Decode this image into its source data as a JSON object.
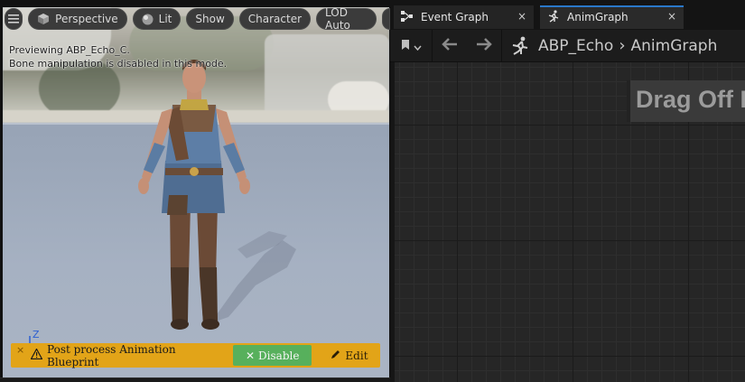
{
  "viewport": {
    "toolbar": {
      "menu_icon": "hamburger-icon",
      "perspective_label": "Perspective",
      "lit_label": "Lit",
      "show_label": "Show",
      "character_label": "Character",
      "lod_label": "LOD Auto"
    },
    "overlay": {
      "line1": "Previewing ABP_Echo_C.",
      "line2": "Bone manipulation is disabled in this mode."
    },
    "axis_label": "Z",
    "warning": {
      "close": "×",
      "text": "Post process Animation Blueprint",
      "disable_label": "Disable",
      "edit_label": "Edit"
    }
  },
  "graph": {
    "tabs": [
      {
        "label": "Event Graph",
        "icon": "event-graph-icon",
        "close": "×"
      },
      {
        "label": "AnimGraph",
        "icon": "running-icon",
        "close": "×"
      }
    ],
    "breadcrumb": {
      "asset": "ABP_Echo",
      "separator": "›",
      "graph": "AnimGraph"
    },
    "hint_text": "Drag Off P"
  },
  "colors": {
    "warning": "#e2a418",
    "disable_button": "#57b05c",
    "active_tab": "#2a78c9",
    "graph_bg": "#262626"
  }
}
